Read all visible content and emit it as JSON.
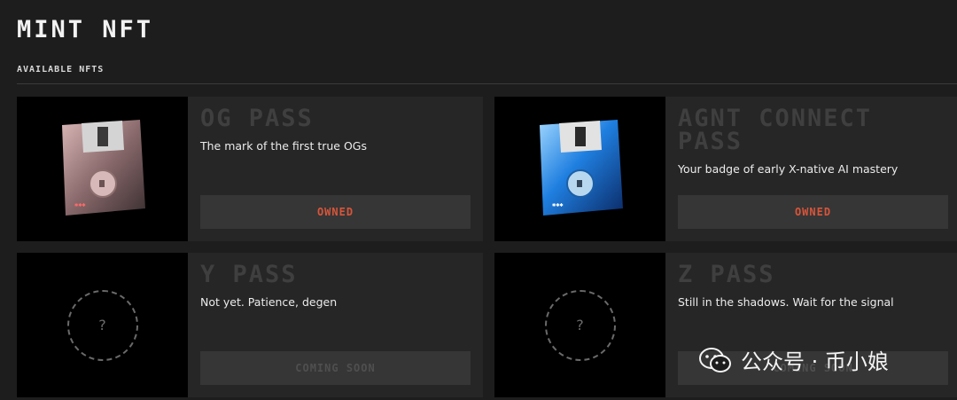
{
  "page": {
    "title": "MINT NFT",
    "section_label": "AVAILABLE NFTS"
  },
  "nfts": [
    {
      "title": "OG PASS",
      "description": "The mark of the first true OGs",
      "status": "OWNED",
      "disk_color": "#b18a8a"
    },
    {
      "title": "AGNT CONNECT PASS",
      "description": "Your badge of early X-native AI mastery",
      "status": "OWNED",
      "disk_color": "#2f8ee8"
    },
    {
      "title": "Y PASS",
      "description": "Not yet. Patience, degen",
      "status": "COMING SOON",
      "placeholder": "?"
    },
    {
      "title": "Z PASS",
      "description": "Still in the shadows. Wait for the signal",
      "status": "COMING SOON",
      "placeholder": "?"
    }
  ],
  "watermark": {
    "text": "公众号 · 币小娘"
  },
  "colors": {
    "background": "#1d1d1d",
    "card": "#262626",
    "owned": "#d8553a",
    "muted_title": "#3f3f3f"
  }
}
